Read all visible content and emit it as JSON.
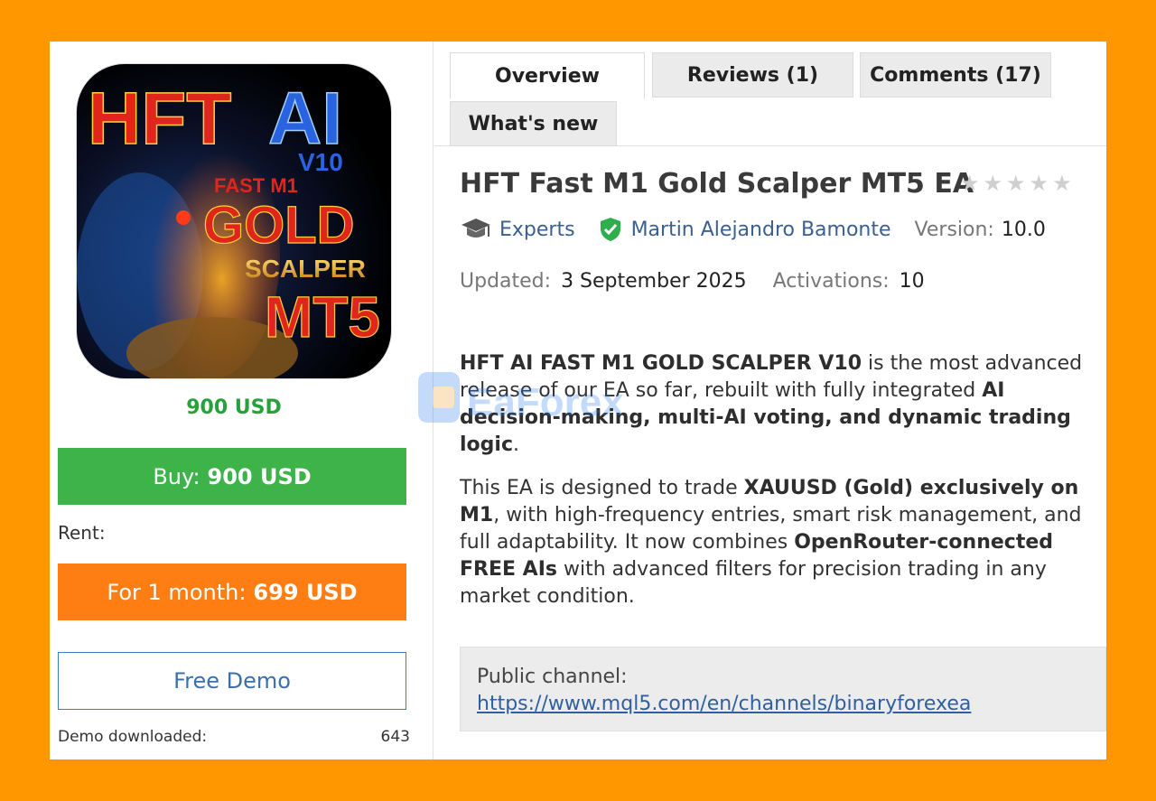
{
  "product": {
    "image_alt": "HFT AI V10 FAST M1 GOLD SCALPER MT5",
    "image_text": {
      "line1a": "HFT",
      "line1b": "AI",
      "line2": "V10",
      "line3": "FAST M1",
      "line4": "GOLD",
      "line5": "SCALPER",
      "line6": "MT5"
    },
    "price": "900 USD",
    "buy_label": "Buy:",
    "buy_price": "900 USD",
    "rent_label": "Rent:",
    "rent_period": "For 1 month:",
    "rent_price": "699 USD",
    "demo_label": "Free Demo",
    "demo_downloaded_label": "Demo downloaded:",
    "demo_downloaded_count": "643"
  },
  "tabs": [
    {
      "label": "Overview",
      "active": true
    },
    {
      "label": "Reviews (1)",
      "active": false
    },
    {
      "label": "Comments (17)",
      "active": false
    },
    {
      "label": "What's new",
      "active": false
    }
  ],
  "details": {
    "title": "HFT Fast M1 Gold Scalper MT5 EA",
    "rating_stars": 0,
    "category": "Experts",
    "author": "Martin Alejandro Bamonte",
    "version_label": "Version:",
    "version": "10.0",
    "updated_label": "Updated:",
    "updated": "3 September 2025",
    "activations_label": "Activations:",
    "activations": "10"
  },
  "description": {
    "p1_bold": "HFT AI FAST M1 GOLD SCALPER V10",
    "p1_text1": " is the most advanced release of our EA so far, rebuilt with fully integrated ",
    "p1_bold2": "AI decision-making, multi-AI voting, and dynamic trading logic",
    "p1_end": ".",
    "p2_text1": "This EA is designed to trade ",
    "p2_bold1": "XAUUSD (Gold) exclusively on M1",
    "p2_text2": ", with high-frequency entries, smart risk management, and full adaptability. It now combines ",
    "p2_bold2": "OpenRouter-connected FREE AIs",
    "p2_text3": " with advanced filters for precision trading in any market condition."
  },
  "channel": {
    "label": "Public channel:",
    "url": "https://www.mql5.com/en/channels/binaryforexea"
  },
  "watermark": "EaForex",
  "colors": {
    "background": "#ff9800",
    "buy": "#3db34a",
    "rent": "#ff7e14",
    "price": "#27a13a",
    "link": "#3a5f92"
  }
}
